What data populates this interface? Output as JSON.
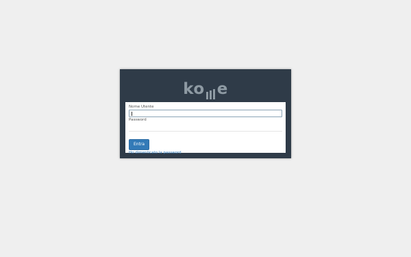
{
  "brand": {
    "logo_text_start": "ko",
    "logo_text_end": "e",
    "logo_color": "#8e9aa3"
  },
  "form": {
    "username_label": "Nome Utente",
    "username_value": "",
    "password_label": "Password",
    "submit_label": "Entra",
    "forgot_label": "Ho dimenticato la password"
  },
  "colors": {
    "background": "#efefef",
    "panel": "#2f3b48",
    "accent": "#337ab7"
  }
}
